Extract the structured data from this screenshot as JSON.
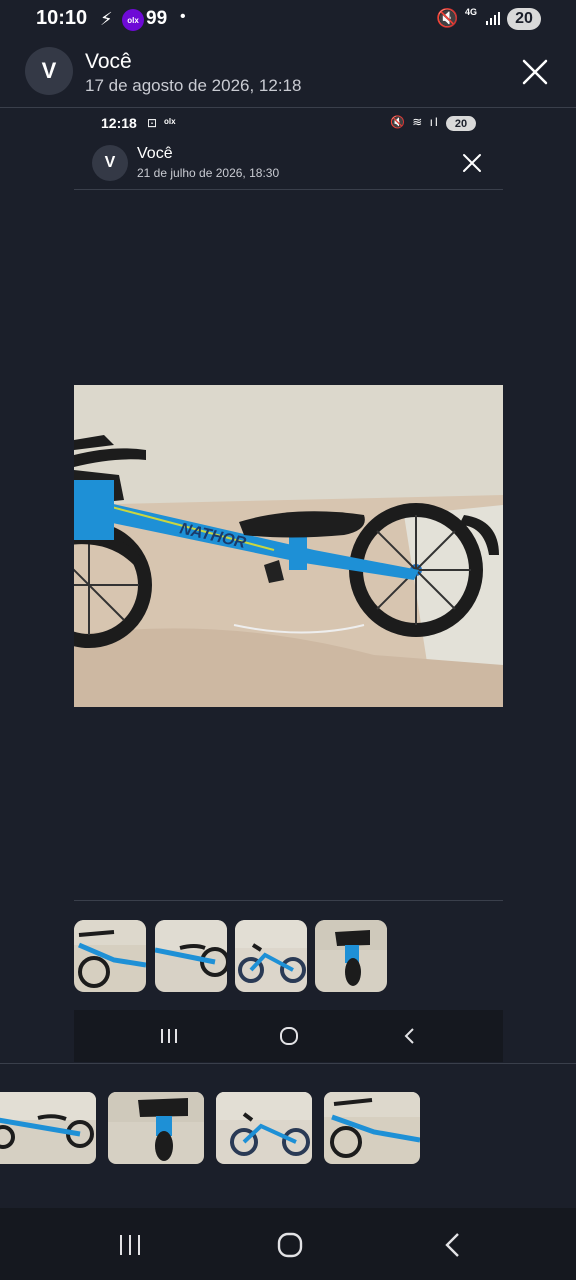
{
  "status_bar": {
    "time": "10:10",
    "app_badge": "99",
    "network": "4G",
    "battery": "20",
    "olx_label": "olx"
  },
  "header": {
    "avatar_letter": "V",
    "sender": "Você",
    "date": "17 de agosto de 2026, 12:18"
  },
  "inner_screenshot": {
    "status_bar": {
      "time": "12:18",
      "battery": "20",
      "olx_label": "olx"
    },
    "header": {
      "avatar_letter": "V",
      "sender": "Você",
      "date": "21 de julho de 2026, 18:30"
    },
    "frame_brand_text": "NATHOR"
  },
  "icons": {
    "close": "close-icon",
    "recents": "recents-icon",
    "home": "home-icon",
    "back": "back-icon",
    "mute": "mute-icon",
    "signal": "signal-icon"
  },
  "colors": {
    "background": "#1b1f2a",
    "bike_blue": "#1e90d6",
    "wall": "#dcd6ca",
    "bed": "#d9c7b2"
  }
}
